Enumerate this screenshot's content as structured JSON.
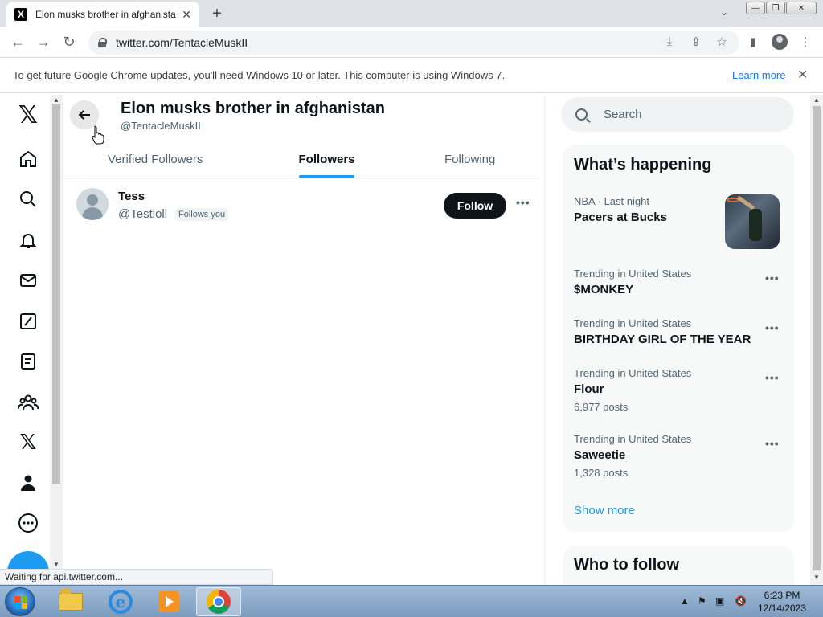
{
  "browser": {
    "tab_title": "Elon musks brother in afghanista",
    "tab_favicon": "X",
    "url": "twitter.com/TentacleMuskII",
    "infobar_message": "To get future Google Chrome updates, you'll need Windows 10 or later. This computer is using Windows 7.",
    "infobar_link": "Learn more",
    "status_text": "Waiting for api.twitter.com..."
  },
  "nav": {
    "items": [
      "x-logo-icon",
      "home-icon",
      "explore-icon",
      "notifications-icon",
      "messages-icon",
      "grok-icon",
      "lists-icon",
      "communities-icon",
      "premium-icon",
      "profile-icon",
      "more-icon"
    ]
  },
  "profile": {
    "name": "Elon musks brother in afghanistan",
    "handle": "@TentacleMuskII",
    "tabs": [
      {
        "label": "Verified Followers",
        "active": false
      },
      {
        "label": "Followers",
        "active": true
      },
      {
        "label": "Following",
        "active": false
      }
    ]
  },
  "followers": [
    {
      "name": "Tess",
      "handle": "@Testloll",
      "badge": "Follows you",
      "button": "Follow"
    }
  ],
  "sidebar": {
    "search_placeholder": "Search",
    "trends_title": "What’s happening",
    "trends": [
      {
        "meta": "NBA · Last night",
        "name": "Pacers at Bucks",
        "count": ""
      },
      {
        "meta": "Trending in United States",
        "name": "$MONKEY",
        "count": ""
      },
      {
        "meta": "Trending in United States",
        "name": "BIRTHDAY GIRL OF THE YEAR",
        "count": ""
      },
      {
        "meta": "Trending in United States",
        "name": "Flour",
        "count": "6,977 posts"
      },
      {
        "meta": "Trending in United States",
        "name": "Saweetie",
        "count": "1,328 posts"
      }
    ],
    "show_more": "Show more",
    "who_to_follow": "Who to follow"
  },
  "taskbar": {
    "apps": [
      "explorer-icon",
      "internet-explorer-icon",
      "media-player-icon",
      "chrome-icon"
    ],
    "time": "6:23 PM",
    "date": "12/14/2023"
  },
  "colors": {
    "accent": "#1d9bf0",
    "text": "#0f1419",
    "muted": "#536471"
  }
}
